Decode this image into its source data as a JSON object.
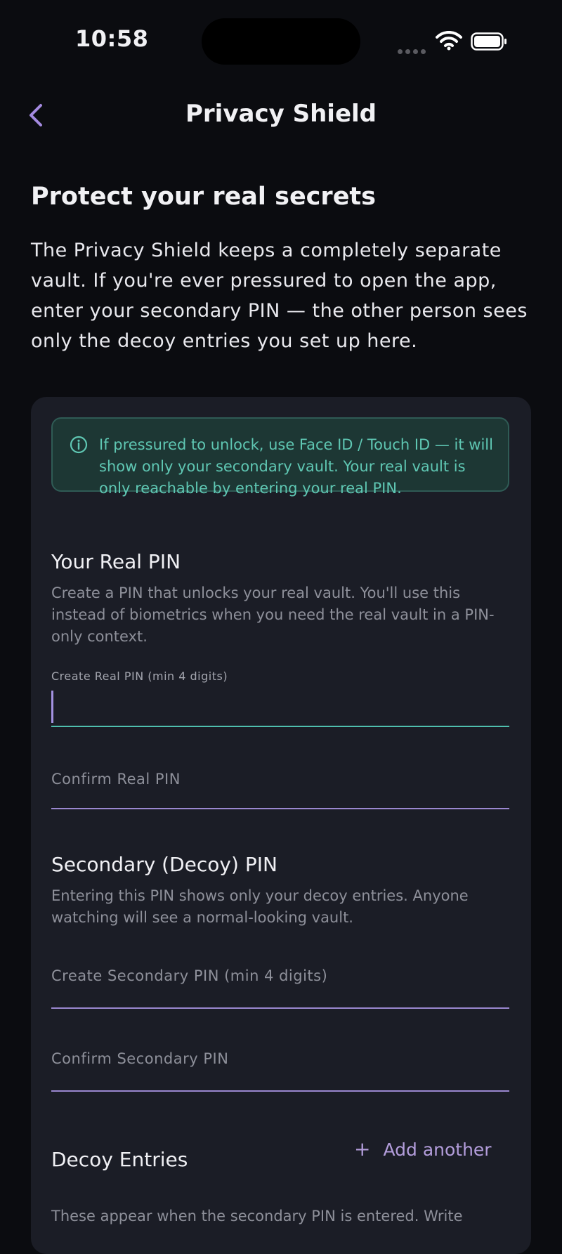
{
  "status": {
    "time": "10:58"
  },
  "nav": {
    "title": "Privacy Shield"
  },
  "intro": {
    "title": "Protect your real secrets",
    "body": "The Privacy Shield keeps a completely separate vault. If you're ever pressured to open the app, enter your secondary PIN — the other person sees only the decoy entries you set up here."
  },
  "info_banner": {
    "text": "If pressured to unlock, use Face ID / Touch ID — it will show only your secondary vault. Your real vault is only reachable by entering your real PIN."
  },
  "real_pin": {
    "title": "Your Real PIN",
    "description": "Create a PIN that unlocks your real vault. You'll use this instead of biometrics when you need the real vault in a PIN-only context.",
    "create_label": "Create Real PIN (min 4 digits)",
    "create_value": "",
    "confirm_placeholder": "Confirm Real PIN"
  },
  "secondary_pin": {
    "title": "Secondary (Decoy) PIN",
    "description": "Entering this PIN shows only your decoy entries. Anyone watching will see a normal-looking vault.",
    "create_placeholder": "Create Secondary PIN (min 4 digits)",
    "confirm_placeholder": "Confirm Secondary PIN"
  },
  "decoy_entries": {
    "title": "Decoy Entries",
    "add_label": "Add another",
    "description": "These appear when the secondary PIN is entered. Write"
  },
  "colors": {
    "background": "#0b0c10",
    "card": "#1b1d26",
    "accent_purple": "#b39ddb",
    "accent_teal": "#5fc7b3"
  }
}
